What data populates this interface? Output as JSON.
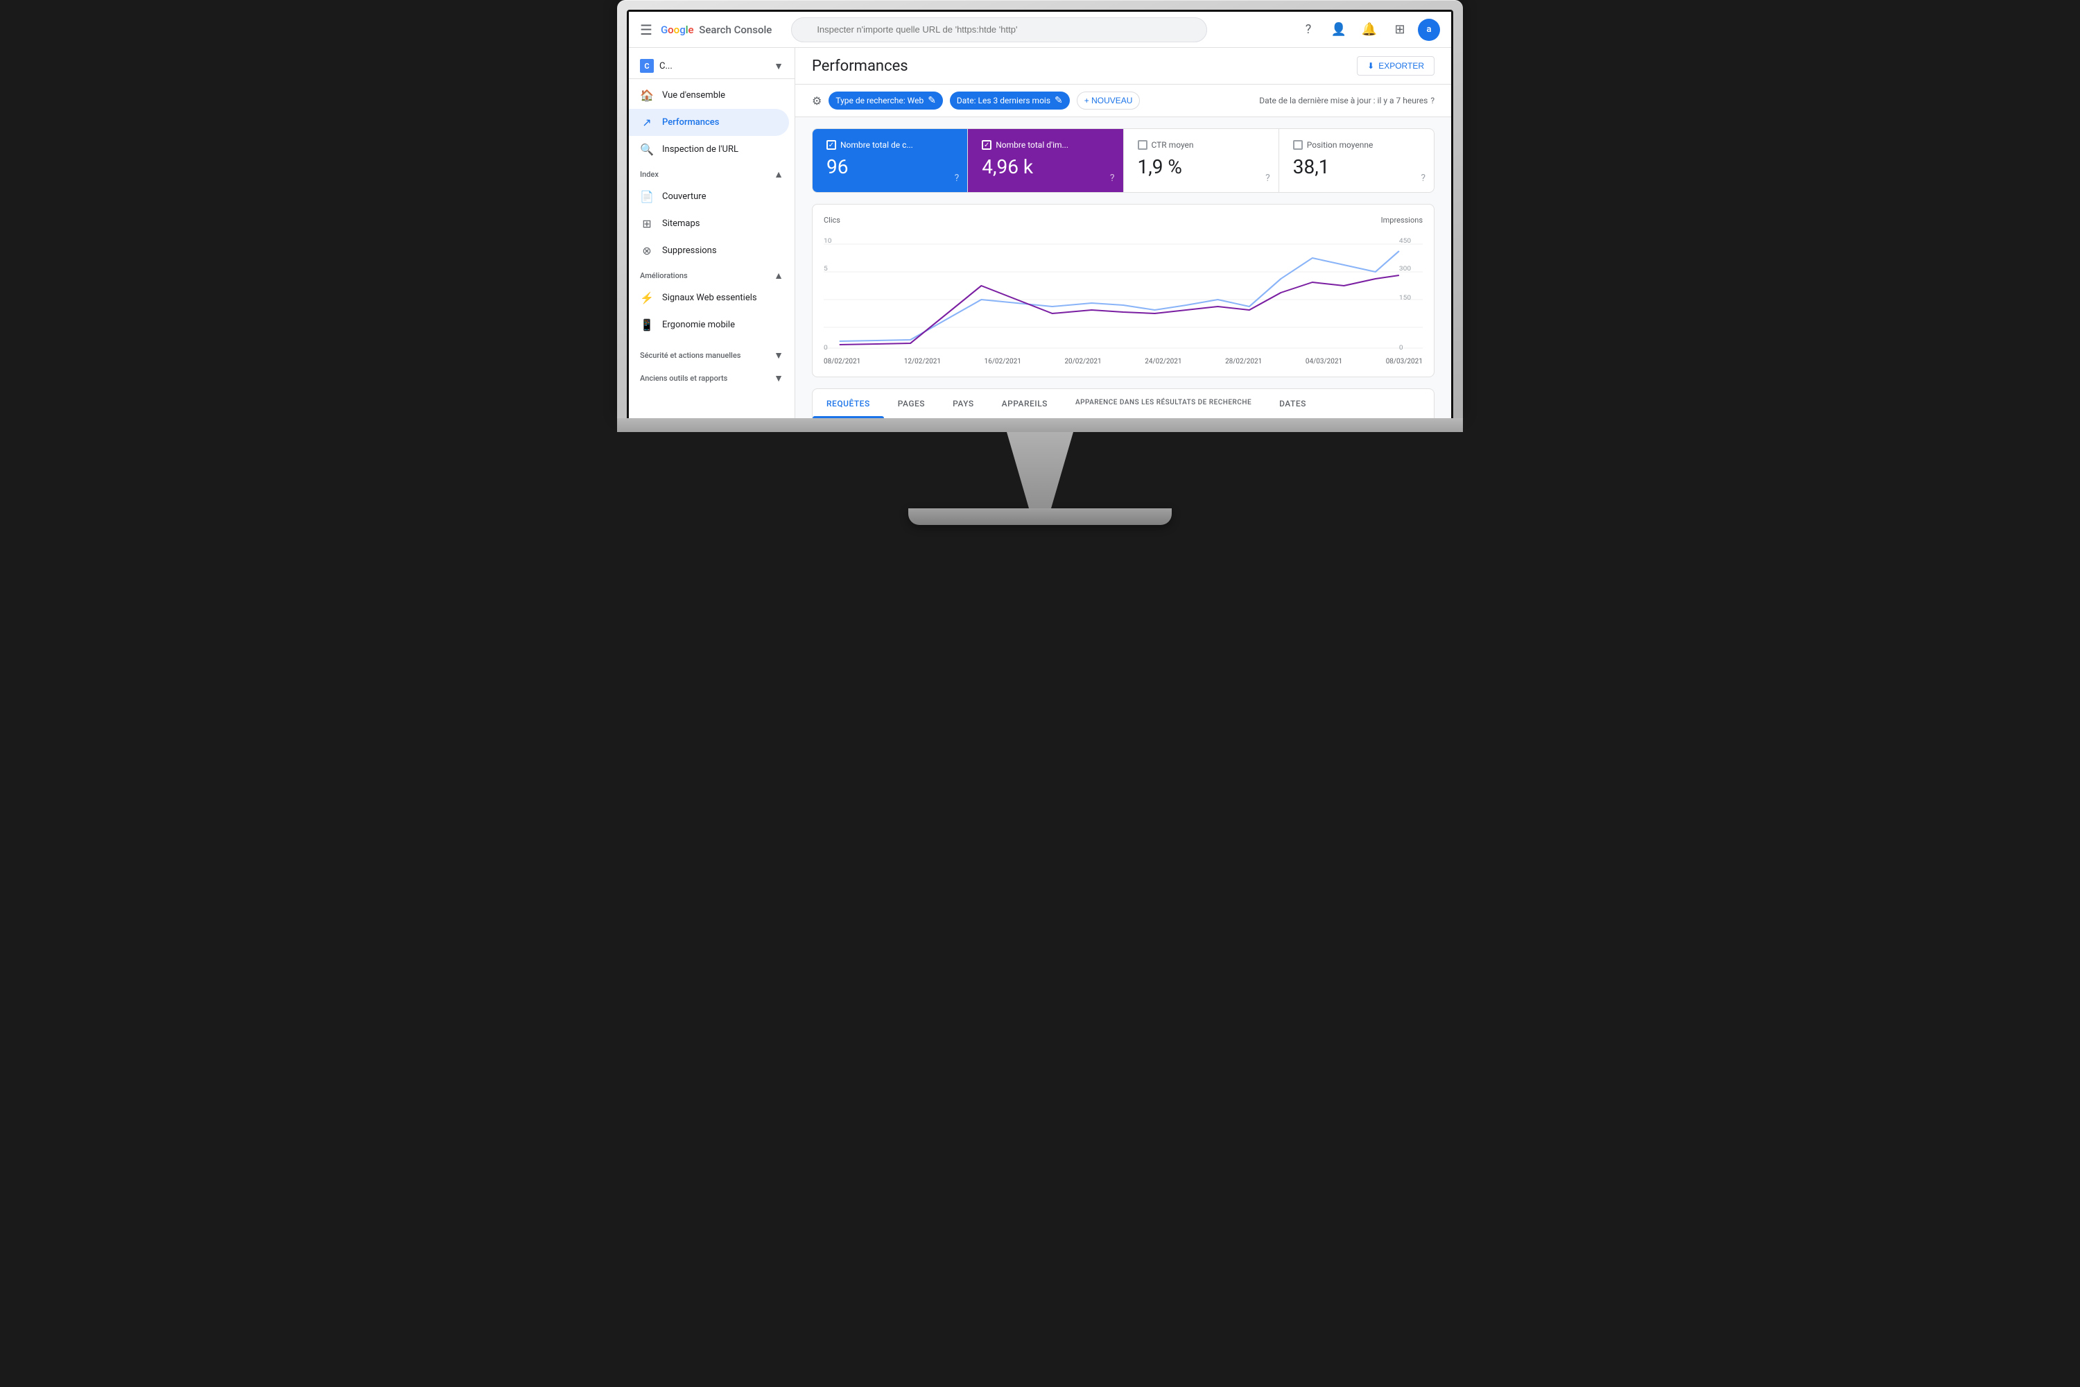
{
  "topbar": {
    "logo": "Google Search Console",
    "search_placeholder": "Inspecter n'importe quelle URL de 'https:htde 'http'",
    "menu_label": "☰"
  },
  "sidebar": {
    "property": {
      "name": "C...",
      "icon": "C"
    },
    "nav_items": [
      {
        "id": "vue-ensemble",
        "label": "Vue d'ensemble",
        "icon": "🏠",
        "active": false
      },
      {
        "id": "performances",
        "label": "Performances",
        "icon": "↗",
        "active": true
      },
      {
        "id": "inspection-url",
        "label": "Inspection de l'URL",
        "icon": "🔍",
        "active": false
      }
    ],
    "sections": [
      {
        "label": "Index",
        "items": [
          {
            "id": "couverture",
            "label": "Couverture",
            "icon": "📄"
          },
          {
            "id": "sitemaps",
            "label": "Sitemaps",
            "icon": "⊞"
          },
          {
            "id": "suppressions",
            "label": "Suppressions",
            "icon": "⊗"
          }
        ]
      },
      {
        "label": "Améliorations",
        "items": [
          {
            "id": "signaux-web",
            "label": "Signaux Web essentiels",
            "icon": "⚡"
          },
          {
            "id": "ergonomie",
            "label": "Ergonomie mobile",
            "icon": "📱"
          }
        ]
      },
      {
        "label": "Sécurité et actions manuelles",
        "items": []
      },
      {
        "label": "Anciens outils et rapports",
        "items": []
      }
    ]
  },
  "content": {
    "page_title": "Performances",
    "export_label": "EXPORTER",
    "filters": {
      "icon": "⚙",
      "chips": [
        {
          "label": "Type de recherche: Web",
          "editable": true
        },
        {
          "label": "Date: Les 3 derniers mois",
          "editable": true
        }
      ],
      "new_label": "+ NOUVEAU",
      "date_info": "Date de la dernière mise à jour : il y a 7 heures"
    },
    "metrics": [
      {
        "id": "clics",
        "label": "Nombre total de c...",
        "value": "96",
        "checked": true,
        "active": "blue"
      },
      {
        "id": "impressions",
        "label": "Nombre total d'im...",
        "value": "4,96 k",
        "checked": true,
        "active": "purple"
      },
      {
        "id": "ctr",
        "label": "CTR moyen",
        "value": "1,9 %",
        "checked": false,
        "active": null
      },
      {
        "id": "position",
        "label": "Position moyenne",
        "value": "38,1",
        "checked": false,
        "active": null
      }
    ],
    "chart": {
      "left_label": "Clics",
      "right_label": "Impressions",
      "y_max_right": 450,
      "y_steps_right": [
        450,
        300,
        150,
        0
      ],
      "y_max_left": 10,
      "dates": [
        "08/02/2021",
        "12/02/2021",
        "16/02/2021",
        "20/02/2021",
        "24/02/2021",
        "28/02/2021",
        "04/03/2021",
        "08/03/2021"
      ]
    },
    "tabs": [
      {
        "id": "requetes",
        "label": "REQUÊTES",
        "active": true
      },
      {
        "id": "pages",
        "label": "PAGES",
        "active": false
      },
      {
        "id": "pays",
        "label": "PAYS",
        "active": false
      },
      {
        "id": "appareils",
        "label": "APPAREILS",
        "active": false
      },
      {
        "id": "apparence",
        "label": "APPARENCE DANS LES RÉSULTATS DE RECHERCHE",
        "active": false
      },
      {
        "id": "dates",
        "label": "DATES",
        "active": false
      }
    ]
  },
  "monitor": {
    "apple_symbol": ""
  }
}
